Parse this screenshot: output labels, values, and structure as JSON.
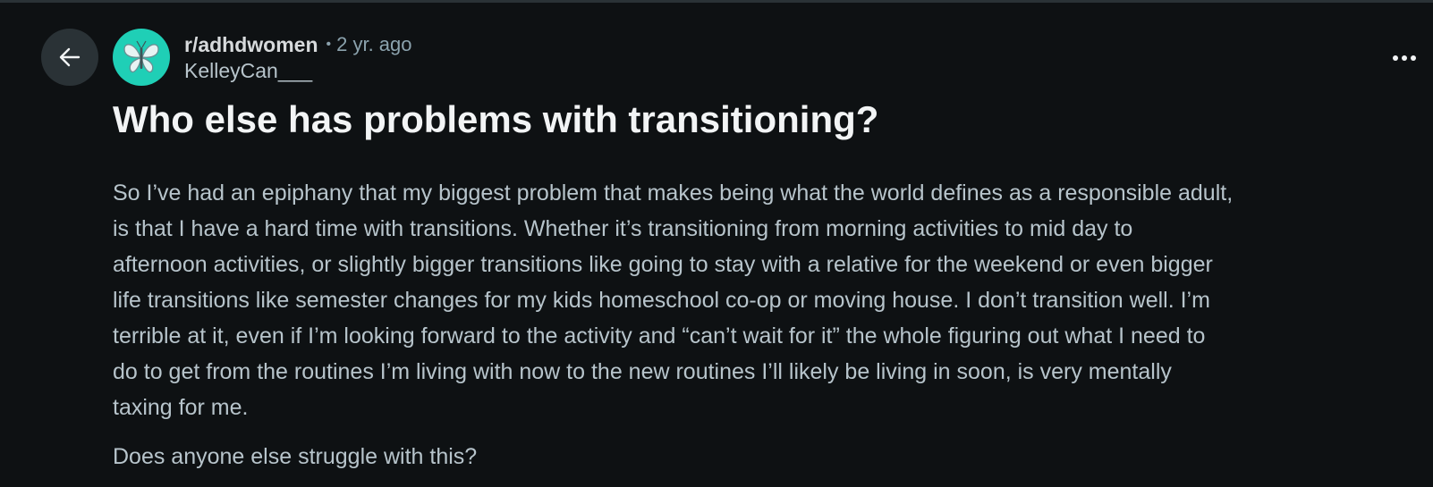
{
  "header": {
    "back_icon": "arrow-left-icon",
    "subreddit": "r/adhdwomen",
    "separator": "•",
    "timestamp": "2 yr. ago",
    "author": "KelleyCan___",
    "avatar_icon": "butterfly-icon",
    "menu_icon": "more-horizontal-icon"
  },
  "post": {
    "title": "Who else has problems with transitioning?",
    "body_lines": [
      "So I’ve had an epiphany that my biggest problem that makes being what the world defines as a responsible adult,",
      "is that I have a hard time with transitions. Whether it’s transitioning from morning activities to mid day to",
      "afternoon activities, or slightly bigger transitions like going to stay with a relative for the weekend or even bigger",
      "life transitions like semester changes for my kids homeschool co-op or moving house. I don’t transition well. I’m",
      "terrible at it, even if I’m looking forward to the activity and “can’t wait for it” the whole figuring out what I need to",
      "do to get from the routines I’m living with now to the new routines I’ll likely be living in soon, is very mentally",
      "taxing for me."
    ],
    "question": "Does anyone else struggle with this?"
  },
  "colors": {
    "background": "#0e1113",
    "avatar_bg": "#1fcfb6",
    "button_bg": "#2a3236",
    "title_text": "#f2f4f5",
    "body_text": "#b7c4cb",
    "meta_text": "#8ba2ad"
  }
}
